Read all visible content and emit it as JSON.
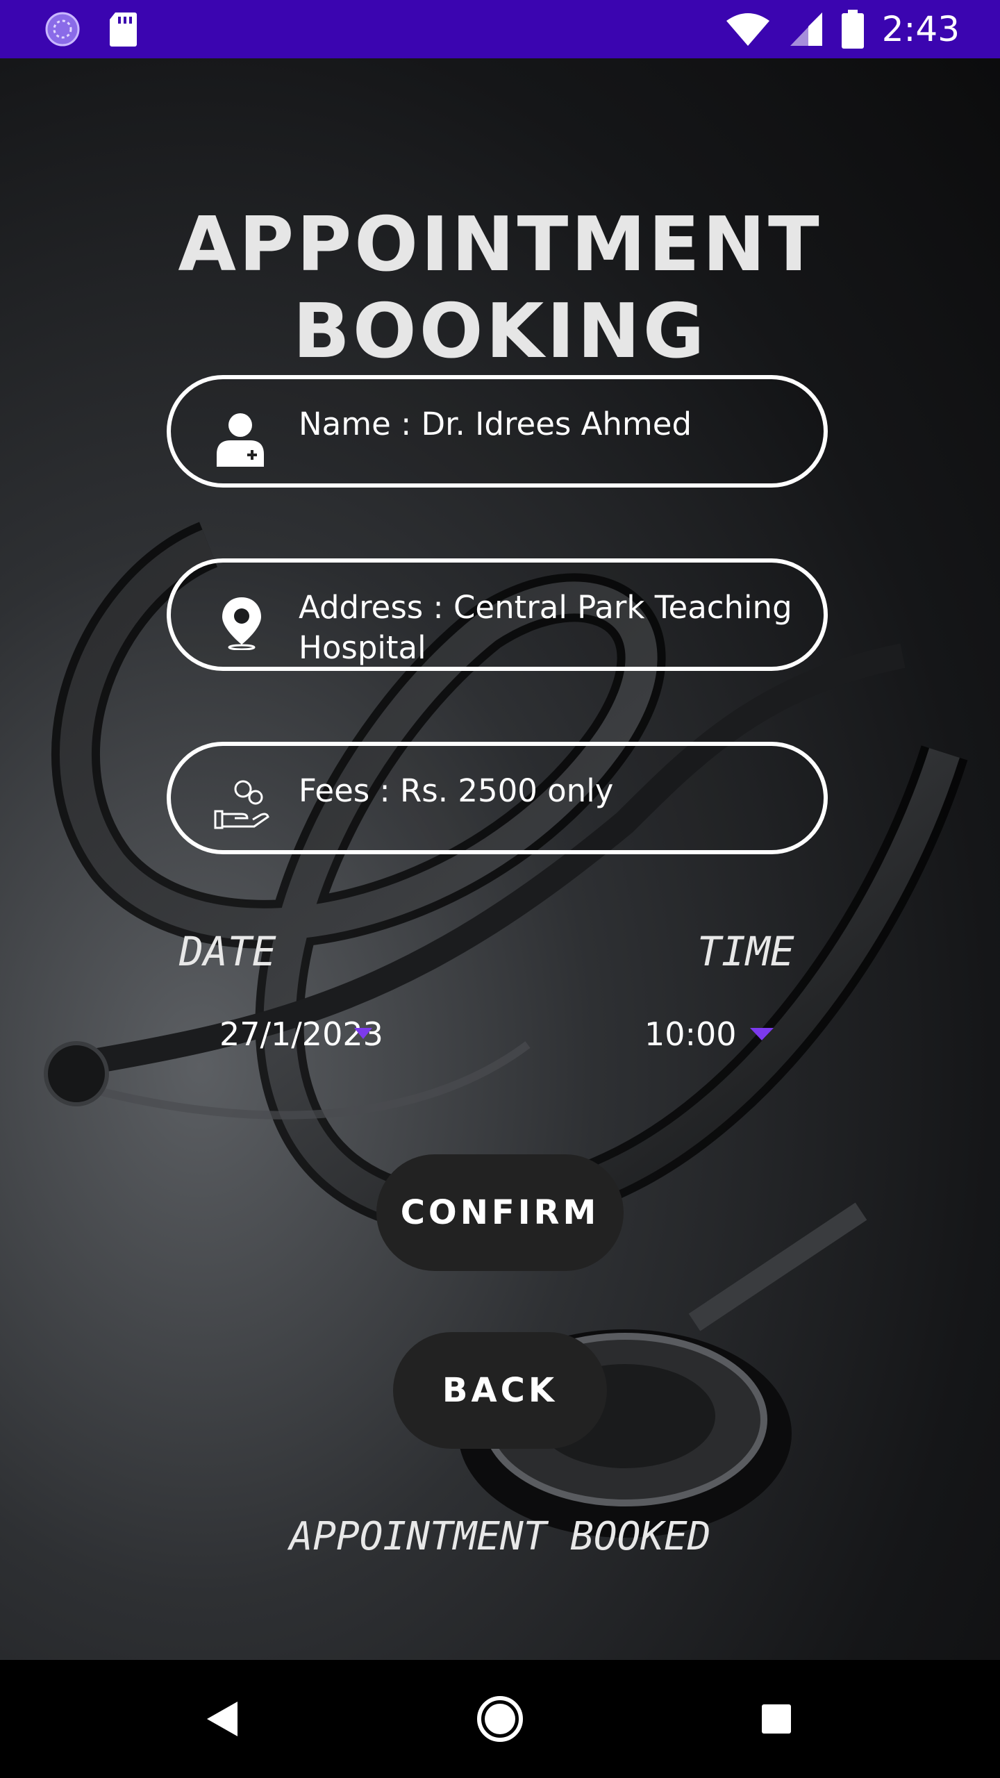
{
  "status_bar": {
    "time": "2:43",
    "icons": [
      "loading-icon",
      "sd-card-icon",
      "wifi-icon",
      "signal-icon",
      "battery-icon"
    ],
    "background_color": "#3b05b0"
  },
  "page": {
    "title": "APPOINTMENT BOOKING"
  },
  "doctor": {
    "name": "Name : Dr. Idrees Ahmed",
    "address": "Address : Central Park Teaching Hospital",
    "fees": "Fees : Rs. 2500 only",
    "icons": [
      "doctor-icon",
      "location-pin-icon",
      "money-hand-icon"
    ]
  },
  "schedule": {
    "date_label": "DATE",
    "time_label": "TIME",
    "date_value": "27/1/2023",
    "time_value": "10:00",
    "dropdown_accent": "#7c3aed"
  },
  "actions": {
    "confirm_label": "CONFIRM",
    "back_label": "BACK"
  },
  "status": {
    "message": "APPOINTMENT BOOKED"
  },
  "nav_bar": {
    "icons": [
      "back-icon",
      "home-icon",
      "recents-icon"
    ]
  }
}
